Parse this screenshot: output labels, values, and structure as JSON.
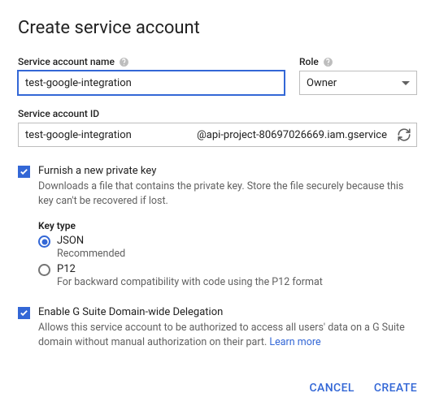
{
  "title": "Create service account",
  "name_field": {
    "label": "Service account name",
    "value": "test-google-integration"
  },
  "role_field": {
    "label": "Role",
    "value": "Owner"
  },
  "id_field": {
    "label": "Service account ID",
    "prefix": "test-google-integration",
    "suffix": "@api-project-80697026669.iam.gservice"
  },
  "furnish": {
    "label": "Furnish a new private key",
    "desc": "Downloads a file that contains the private key. Store the file securely because this key can't be recovered if lost."
  },
  "key_type": {
    "title": "Key type",
    "json_label": "JSON",
    "json_desc": "Recommended",
    "p12_label": "P12",
    "p12_desc": "For backward compatibility with code using the P12 format"
  },
  "delegation": {
    "label": "Enable G Suite Domain-wide Delegation",
    "desc": "Allows this service account to be authorized to access all users' data on a G Suite domain without manual authorization on their part. ",
    "learn_more": "Learn more"
  },
  "buttons": {
    "cancel": "CANCEL",
    "create": "CREATE"
  }
}
